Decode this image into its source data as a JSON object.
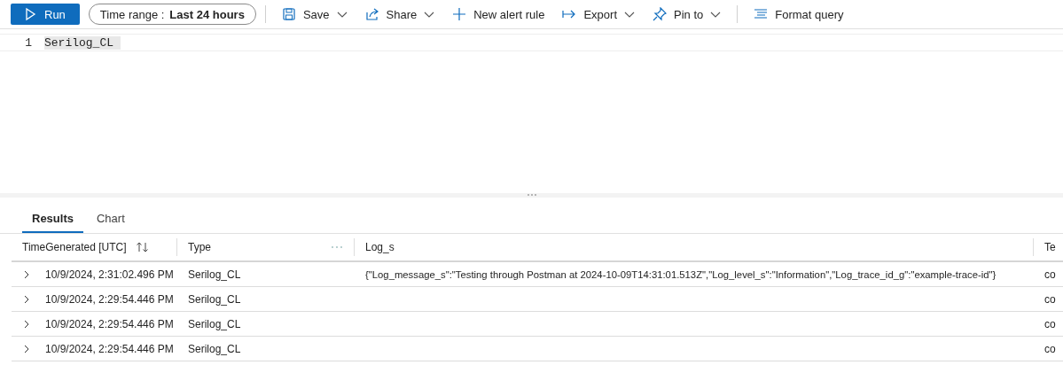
{
  "toolbar": {
    "run": {
      "label": "Run"
    },
    "time_range": {
      "label": "Time range :",
      "value": "Last 24 hours"
    },
    "groups": [
      [
        {
          "label": "Save",
          "dropdown": true
        },
        {
          "label": "Share",
          "dropdown": true
        },
        {
          "label": "New alert rule",
          "dropdown": false
        },
        {
          "label": "Export",
          "dropdown": true
        },
        {
          "label": "Pin to",
          "dropdown": true
        }
      ],
      [
        {
          "label": "Format query",
          "dropdown": false
        }
      ]
    ]
  },
  "editor": {
    "lines": [
      {
        "number": "1",
        "text": "Serilog_CL"
      }
    ]
  },
  "results": {
    "tabs": [
      {
        "label": "Results",
        "selected": true
      },
      {
        "label": "Chart",
        "selected": false
      }
    ],
    "table": {
      "columns": [
        "TimeGenerated [UTC]",
        "Type",
        "Log_s",
        "Te"
      ],
      "rows": [
        [
          "10/9/2024, 2:31:02.496 PM",
          "Serilog_CL",
          "{\"Log_message_s\":\"Testing through Postman at 2024-10-09T14:31:01.513Z\",\"Log_level_s\":\"Information\",\"Log_trace_id_g\":\"example-trace-id\"}",
          "co"
        ],
        [
          "10/9/2024, 2:29:54.446 PM",
          "Serilog_CL",
          "",
          "co"
        ],
        [
          "10/9/2024, 2:29:54.446 PM",
          "Serilog_CL",
          "",
          "co"
        ],
        [
          "10/9/2024, 2:29:54.446 PM",
          "Serilog_CL",
          "",
          "co"
        ]
      ]
    }
  }
}
